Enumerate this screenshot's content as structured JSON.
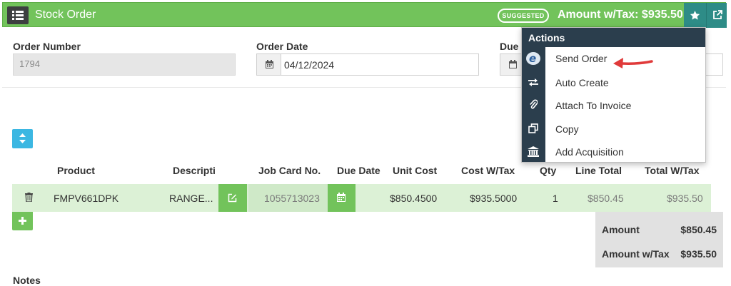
{
  "header": {
    "title": "Stock Order",
    "status_badge": "SUGGESTED",
    "amount_with_tax": "Amount w/Tax: $935.50",
    "menu_icon": "list-icon",
    "favorite_icon": "star-icon",
    "open_icon": "external-link-icon",
    "bar_color": "#72c35b"
  },
  "form": {
    "order_number_label": "Order Number",
    "order_number_value": "1794",
    "order_date_label": "Order Date",
    "order_date_value": "04/12/2024",
    "due_label": "Due"
  },
  "table": {
    "headers": [
      "Product",
      "Descripti",
      "Job Card No.",
      "Due Date",
      "Unit Cost",
      "Cost W/Tax",
      "Qty",
      "Line Total",
      "Total W/Tax"
    ],
    "rows": [
      {
        "product": "FMPV661DPK",
        "description": "RANGE...",
        "job_card_no": "1055713023",
        "unit_cost": "$850.4500",
        "cost_w_tax": "$935.5000",
        "qty": "1",
        "line_total": "$850.45",
        "total_w_tax": "$935.50"
      }
    ]
  },
  "totals": {
    "amount_label": "Amount",
    "amount_value": "$850.45",
    "amount_tax_label": "Amount w/Tax",
    "amount_tax_value": "$935.50"
  },
  "notes_label": "Notes",
  "actions_menu": {
    "title": "Actions",
    "items": [
      {
        "label": "Send Order",
        "icon": "e-logo-icon"
      },
      {
        "label": "Auto Create",
        "icon": "exchange-icon"
      },
      {
        "label": "Attach To Invoice",
        "icon": "paperclip-icon"
      },
      {
        "label": "Copy",
        "icon": "copy-icon"
      },
      {
        "label": "Add Acquisition",
        "icon": "bank-icon"
      }
    ]
  },
  "colors": {
    "green": "#72c35b",
    "teal": "#2e8c87",
    "menu_dark": "#2b3e4d",
    "row_green": "#dcf1d6",
    "sort_blue": "#3bb7e2",
    "annotation_red": "#e03a3a"
  }
}
